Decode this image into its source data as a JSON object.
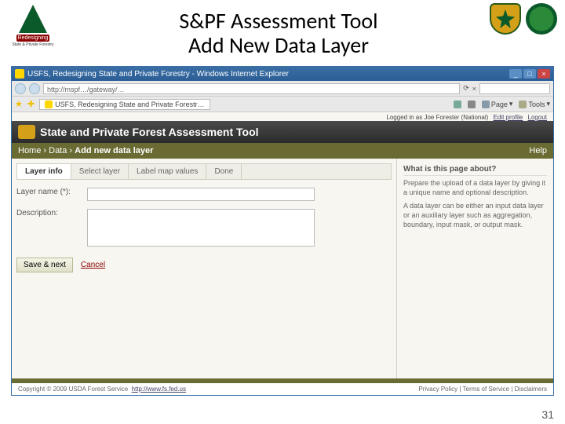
{
  "slide": {
    "title_l1": "S&PF Assessment Tool",
    "title_l2": "Add New Data Layer",
    "number": "31",
    "logo_banner": "Redesigning",
    "logo_sub": "State & Private Forestry"
  },
  "ie": {
    "title": "USFS, Redesigning State and Private Forestry - Windows Internet Explorer",
    "address": "http://mspf…/gateway/…",
    "tab": "USFS, Redesigning State and Private Forestr…",
    "tool_page": "Page",
    "tool_tools": "Tools",
    "min": "_",
    "max": "□",
    "close": "×",
    "refresh": "⟳",
    "dd": "▾"
  },
  "page": {
    "app_title": "State and Private Forest Assessment Tool",
    "logged_in": "Logged in as Joe Forester (National)",
    "edit_profile": "Edit profile",
    "logout": "Logout",
    "breadcrumb": {
      "home": "Home",
      "data": "Data",
      "current": "Add new data layer",
      "help": "Help"
    },
    "wizard": [
      "Layer info",
      "Select layer",
      "Label map values",
      "Done"
    ],
    "form": {
      "layer_name_label": "Layer name (*):",
      "layer_name_value": "",
      "description_label": "Description:",
      "description_value": "",
      "save_next": "Save & next",
      "cancel": "Cancel"
    },
    "sidebar": {
      "heading": "What is this page about?",
      "p1": "Prepare the upload of a data layer by giving it a unique name and optional description.",
      "p2": "A data layer can be either an input data layer or an auxiliary layer such as aggregation, boundary, input mask, or output mask."
    },
    "footer": {
      "copyright": "Copyright © 2009 USDA Forest Service",
      "link": "http://www.fs.fed.us",
      "right": "Privacy Policy | Terms of Service | Disclaimers"
    }
  }
}
